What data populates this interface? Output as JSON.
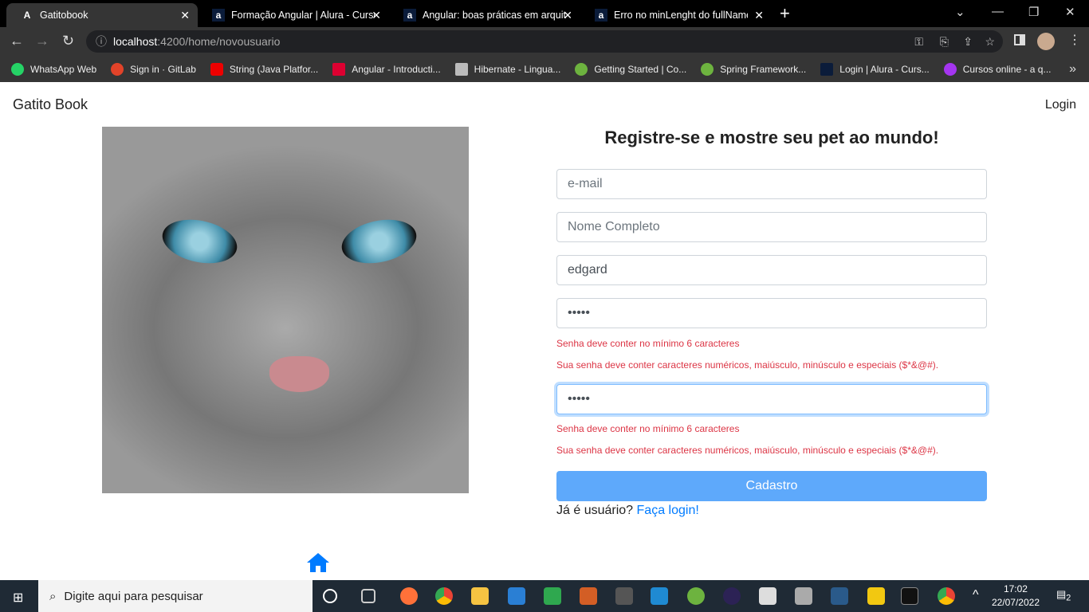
{
  "browser": {
    "tabs": [
      {
        "label": "Gatitobook",
        "icon": "angular-icon",
        "active": true
      },
      {
        "label": "Formação Angular | Alura - Cursos",
        "icon": "alura-icon"
      },
      {
        "label": "Angular: boas práticas em arquitetura",
        "icon": "alura-icon"
      },
      {
        "label": "Erro no minLenght do fullName | Alura",
        "icon": "alura-icon"
      }
    ],
    "url_host": "localhost",
    "url_path": ":4200/home/novousuario",
    "bookmarks": [
      {
        "label": "WhatsApp Web",
        "color": "#25d366"
      },
      {
        "label": "Sign in · GitLab",
        "color": "#e24329"
      },
      {
        "label": "String (Java Platfor...",
        "color": "#e00"
      },
      {
        "label": "Angular - Introducti...",
        "color": "#dd0031"
      },
      {
        "label": "Hibernate - Lingua...",
        "color": "#bbb"
      },
      {
        "label": "Getting Started | Co...",
        "color": "#6db33f"
      },
      {
        "label": "Spring Framework...",
        "color": "#6db33f"
      },
      {
        "label": "Login | Alura - Curs...",
        "color": "#0b1c3a"
      },
      {
        "label": "Cursos online - a q...",
        "color": "#a435f0"
      }
    ]
  },
  "page": {
    "brand": "Gatito Book",
    "login": "Login",
    "title": "Registre-se e mostre seu pet ao mundo!",
    "email_placeholder": "e-mail",
    "name_placeholder": "Nome Completo",
    "username_value": "edgard",
    "password_value": "•••••",
    "confirm_value": "•••••",
    "err_min": "Senha deve conter no mínimo 6 caracteres",
    "err_pattern": "Sua senha deve conter caracteres numéricos, maiúsculo, minúsculo e especiais ($*&@#).",
    "submit": "Cadastro",
    "already": "Já é usuário?",
    "login_link": "Faça login!",
    "accent": "#007bff"
  },
  "taskbar": {
    "search_placeholder": "Digite aqui para pesquisar",
    "time": "17:02",
    "date": "22/07/2022",
    "notifications": "2"
  }
}
